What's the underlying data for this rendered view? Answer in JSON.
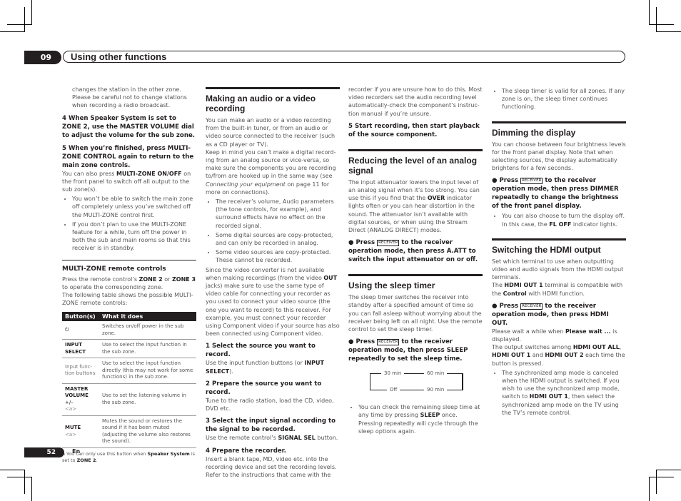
{
  "header": {
    "chapter_number": "09",
    "chapter_title": "Using other functions"
  },
  "footer": {
    "page_number": "52",
    "language": "En"
  },
  "col1": {
    "intro_cont": "changes the station in the other zone. Please be careful not to change stations when recording a radio broadcast.",
    "step4": "4   When Speaker System is set to ZONE 2, use the MASTER VOLUME dial to adjust the volume for the sub zone.",
    "step5": "5   When you’re finished, press MULTI-ZONE CONTROL again to return to the main zone controls.",
    "step5_body_a": "You can also press ",
    "step5_body_b": "MULTI-ZONE ON/OFF",
    "step5_body_c": " on the front panel to switch off all output to the sub zone(s).",
    "bullets": [
      "You won’t be able to switch the main zone off completely unless you’ve switched off the MULTI-ZONE control first.",
      "If you don’t plan to use the MULTI-ZONE feature for a while, turn off the power in both the sub and main rooms so that this receiver is in standby."
    ],
    "remote_heading": "MULTI-ZONE remote controls",
    "remote_p1_a": "Press the remote control’s ",
    "remote_p1_b": "ZONE 2",
    "remote_p1_c": " or ",
    "remote_p1_d": "ZONE 3",
    "remote_p1_e": " to operate the corresponding zone.",
    "remote_p2": "The following table shows the possible MULTI-ZONE remote controls:",
    "table": {
      "headers": [
        "Button(s)",
        "What it does"
      ],
      "rows": [
        {
          "button": "⏻",
          "desc": "Switches on/off power in the sub zone."
        },
        {
          "button": "INPUT SELECT",
          "desc": "Use to select the input function in the sub zone."
        },
        {
          "button": "Input func-tion buttons",
          "desc": "Use to select the input function directly (this may not work for some functions) in the sub zone."
        },
        {
          "button": "MASTER VOLUME",
          "sub": "+/–",
          "note": "<a>",
          "desc": "Use to set the listening volume in the sub zone."
        },
        {
          "button": "MUTE",
          "note": "<a>",
          "desc": "Mutes the sound or restores the sound if it has been muted (adjusting the volume also restores the sound)."
        }
      ]
    },
    "footnote_a": "a  You can only use this button when ",
    "footnote_b": "Speaker System",
    "footnote_c": " is set to ",
    "footnote_d": "ZONE 2",
    "footnote_e": "."
  },
  "col2": {
    "heading": "Making an audio or a video recording",
    "p1": "You can make an audio or a video recording from the built-in tuner, or from an audio or video source connected to the receiver (such as a CD player or TV).",
    "p2_a": "Keep in mind you can’t make a digital record-ing from an analog source or vice-versa, so make sure the components you are recording to/from are hooked up in the same way (see ",
    "p2_link": "Connecting your equipment",
    "p2_b": " on page 11 for more on connections).",
    "bullets": [
      "The receiver’s volume, Audio parameters (the tone controls, for example), and surround effects have no effect on the recorded signal.",
      "Some digital sources are copy-protected, and can only be recorded in analog.",
      "Some video sources are copy-protected. These cannot be recorded."
    ],
    "p3_a": "Since the video converter is not available when making recordings (from the video ",
    "p3_b": "OUT",
    "p3_c": " jacks) make sure to use the same type of video cable for connecting your recorder as you used to connect your video source (the one you want to record) to this receiver. For example, you must connect your recorder using Component video if your source has also been connected using Component video.",
    "s1": "1   Select the source you want to record.",
    "s1_a": "Use the input function buttons (or ",
    "s1_b": "INPUT SELECT",
    "s1_c": ").",
    "s2": "2   Prepare the source you want to record.",
    "s2_body": "Tune to the radio station, load the CD, video, DVD etc.",
    "s3": "3   Select the input signal according to the signal to be recorded.",
    "s3_a": "Use the remote control’s ",
    "s3_b": "SIGNAL SEL",
    "s3_c": " button.",
    "s4": "4   Prepare the recorder.",
    "s4_body": "Insert a blank tape, MD, video etc. into the recording device and set the recording levels. Refer to the instructions that came with the"
  },
  "col3": {
    "cont": "recorder if you are unsure how to do this. Most video recorders set the audio recording level automatically-check the component’s instruc-tion manual if you’re unsure.",
    "s5": "5   Start recording, then start playback of the source component.",
    "att_heading": "Reducing the level of an analog signal",
    "att_p_a": "The input attenuator lowers the input level of an analog signal when it’s too strong. You can use this if you find that the ",
    "att_p_b": "OVER",
    "att_p_c": " indicator lights often or you can hear distortion in the sound. The attenuator isn’t available with digital sources, or when using the Stream Direct (ANALOG DIRECT) modes.",
    "receiver_key": "RECEIVER",
    "att_step_a": "●   Press ",
    "att_step_b": " to the receiver operation mode, then press A.ATT  to switch the input attenuator on or off.",
    "sleep_heading": "Using the sleep timer",
    "sleep_p": "The sleep timer switches the receiver into standby after a specified amount of time so you can fall asleep without worrying about the receiver being left on all night. Use the remote control to set the sleep timer.",
    "sleep_step_b": " to the receiver operation mode, then press SLEEP  repeatedly to set the sleep time.",
    "cycle": [
      "30 min",
      "60 min",
      "90 min",
      "Off"
    ],
    "sleep_bullet_a": "You can check the remaining sleep time at any time by pressing ",
    "sleep_bullet_b": "SLEEP",
    "sleep_bullet_c": " once. Pressing repeatedly will cycle through the sleep options again."
  },
  "col4": {
    "sleep_bullet2": "The sleep timer is valid for all zones. If any zone is on, the sleep timer continues functioning.",
    "dim_heading": "Dimming the display",
    "dim_p": "You can choose between four brightness levels for the front panel display. Note that when selecting sources, the display automatically brightens for a few seconds.",
    "dim_step_b": " to the receiver operation mode, then press DIMMER  repeatedly to change the brightness of the front panel display.",
    "dim_bullet_a": "You can also choose to turn the display off. In this case, the ",
    "dim_bullet_b": "FL OFF",
    "dim_bullet_c": " indicator lights.",
    "hdmi_heading": "Switching the HDMI output",
    "hdmi_p1": "Set which terminal to use when outputting video and audio signals from the HDMI output terminals.",
    "hdmi_p2_a": "The ",
    "hdmi_p2_b": "HDMI OUT 1",
    "hdmi_p2_c": " terminal is compatible with the ",
    "hdmi_p2_d": "Control",
    "hdmi_p2_e": " with HDMI function.",
    "hdmi_step_b": " to the receiver operation mode, then press HDMI OUT.",
    "hdmi_p3_a": "Please wait a while when ",
    "hdmi_p3_b": "Please wait ...",
    "hdmi_p3_c": " is displayed.",
    "hdmi_p4_a": "The output switches among ",
    "hdmi_p4_b": "HDMI OUT ALL",
    "hdmi_p4_c": ", ",
    "hdmi_p4_d": "HDMI OUT 1",
    "hdmi_p4_e": " and ",
    "hdmi_p4_f": "HDMI OUT 2",
    "hdmi_p4_g": " each time the button is pressed.",
    "hdmi_bullet_a": "The synchronized amp mode is canceled when the HDMI output is switched. If you wish to use the synchronized amp mode, switch to ",
    "hdmi_bullet_b": "HDMI OUT 1",
    "hdmi_bullet_c": ", then select the synchronized amp mode on the TV using the TV’s remote control."
  }
}
